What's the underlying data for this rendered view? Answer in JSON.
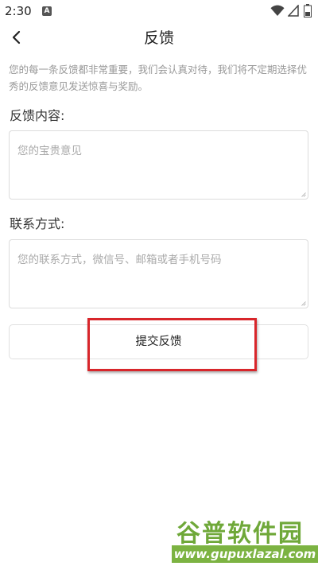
{
  "status_bar": {
    "time": "2:30",
    "notification_letter": "A"
  },
  "header": {
    "title": "反馈"
  },
  "intro": "您的每一条反馈都非常重要，我们会认真对待，我们将不定期选择优秀的反馈意见发送惊喜与奖励。",
  "feedback": {
    "label": "反馈内容:",
    "placeholder": "您的宝贵意见",
    "value": ""
  },
  "contact": {
    "label": "联系方式:",
    "placeholder": "您的联系方式，微信号、邮箱或者手机号码",
    "value": ""
  },
  "submit": {
    "label": "提交反馈"
  },
  "watermark": {
    "logo": "谷普软件园",
    "url": "www.gupuxlazal.com"
  },
  "colors": {
    "highlight": "#d8262b",
    "watermark_green": "#7cb342"
  }
}
